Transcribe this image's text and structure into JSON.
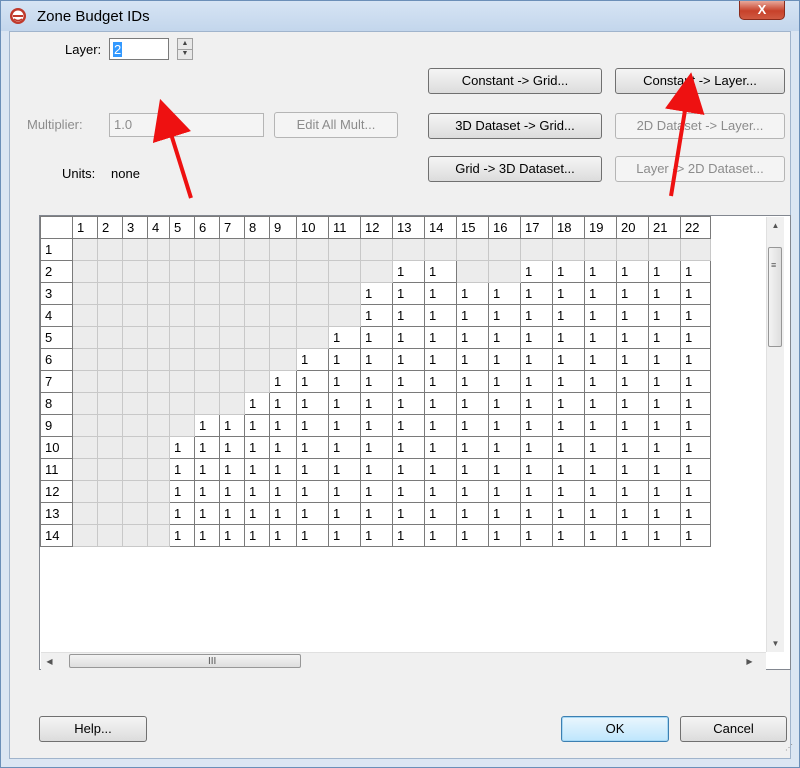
{
  "window": {
    "title": "Zone Budget IDs",
    "close_label": "X"
  },
  "form": {
    "layer_label": "Layer:",
    "layer_value": "2",
    "multiplier_label": "Multiplier:",
    "multiplier_value": "1.0",
    "units_label": "Units:",
    "units_value": "none",
    "edit_all_mult": "Edit All Mult..."
  },
  "buttons": {
    "constant_grid": "Constant -> Grid...",
    "constant_layer": "Constant -> Layer...",
    "dataset_3d_grid": "3D Dataset -> Grid...",
    "dataset_2d_layer": "2D Dataset -> Layer...",
    "grid_3d_dataset": "Grid -> 3D Dataset...",
    "layer_2d_dataset": "Layer -> 2D Dataset...",
    "help": "Help...",
    "ok": "OK",
    "cancel": "Cancel"
  },
  "grid": {
    "columns": [
      "1",
      "2",
      "3",
      "4",
      "5",
      "6",
      "7",
      "8",
      "9",
      "10",
      "11",
      "12",
      "13",
      "14",
      "15",
      "16",
      "17",
      "18",
      "19",
      "20",
      "21",
      "22"
    ],
    "rows": [
      {
        "label": "1",
        "cells": [
          "",
          "",
          "",
          "",
          "",
          "",
          "",
          "",
          "",
          "",
          "",
          "",
          "",
          "",
          "",
          "",
          "",
          "",
          "",
          "",
          "",
          ""
        ]
      },
      {
        "label": "2",
        "cells": [
          "",
          "",
          "",
          "",
          "",
          "",
          "",
          "",
          "",
          "",
          "",
          "",
          "1",
          "1",
          "",
          "",
          "1",
          "1",
          "1",
          "1",
          "1",
          "1"
        ]
      },
      {
        "label": "3",
        "cells": [
          "",
          "",
          "",
          "",
          "",
          "",
          "",
          "",
          "",
          "",
          "",
          "1",
          "1",
          "1",
          "1",
          "1",
          "1",
          "1",
          "1",
          "1",
          "1",
          "1"
        ]
      },
      {
        "label": "4",
        "cells": [
          "",
          "",
          "",
          "",
          "",
          "",
          "",
          "",
          "",
          "",
          "",
          "1",
          "1",
          "1",
          "1",
          "1",
          "1",
          "1",
          "1",
          "1",
          "1",
          "1"
        ]
      },
      {
        "label": "5",
        "cells": [
          "",
          "",
          "",
          "",
          "",
          "",
          "",
          "",
          "",
          "",
          "1",
          "1",
          "1",
          "1",
          "1",
          "1",
          "1",
          "1",
          "1",
          "1",
          "1",
          "1"
        ]
      },
      {
        "label": "6",
        "cells": [
          "",
          "",
          "",
          "",
          "",
          "",
          "",
          "",
          "",
          "1",
          "1",
          "1",
          "1",
          "1",
          "1",
          "1",
          "1",
          "1",
          "1",
          "1",
          "1",
          "1"
        ]
      },
      {
        "label": "7",
        "cells": [
          "",
          "",
          "",
          "",
          "",
          "",
          "",
          "",
          "1",
          "1",
          "1",
          "1",
          "1",
          "1",
          "1",
          "1",
          "1",
          "1",
          "1",
          "1",
          "1",
          "1"
        ]
      },
      {
        "label": "8",
        "cells": [
          "",
          "",
          "",
          "",
          "",
          "",
          "",
          "1",
          "1",
          "1",
          "1",
          "1",
          "1",
          "1",
          "1",
          "1",
          "1",
          "1",
          "1",
          "1",
          "1",
          "1"
        ]
      },
      {
        "label": "9",
        "cells": [
          "",
          "",
          "",
          "",
          "",
          "1",
          "1",
          "1",
          "1",
          "1",
          "1",
          "1",
          "1",
          "1",
          "1",
          "1",
          "1",
          "1",
          "1",
          "1",
          "1",
          "1"
        ]
      },
      {
        "label": "10",
        "cells": [
          "",
          "",
          "",
          "",
          "1",
          "1",
          "1",
          "1",
          "1",
          "1",
          "1",
          "1",
          "1",
          "1",
          "1",
          "1",
          "1",
          "1",
          "1",
          "1",
          "1",
          "1"
        ]
      },
      {
        "label": "11",
        "cells": [
          "",
          "",
          "",
          "",
          "1",
          "1",
          "1",
          "1",
          "1",
          "1",
          "1",
          "1",
          "1",
          "1",
          "1",
          "1",
          "1",
          "1",
          "1",
          "1",
          "1",
          "1"
        ]
      },
      {
        "label": "12",
        "cells": [
          "",
          "",
          "",
          "",
          "1",
          "1",
          "1",
          "1",
          "1",
          "1",
          "1",
          "1",
          "1",
          "1",
          "1",
          "1",
          "1",
          "1",
          "1",
          "1",
          "1",
          "1"
        ]
      },
      {
        "label": "13",
        "cells": [
          "",
          "",
          "",
          "",
          "1",
          "1",
          "1",
          "1",
          "1",
          "1",
          "1",
          "1",
          "1",
          "1",
          "1",
          "1",
          "1",
          "1",
          "1",
          "1",
          "1",
          "1"
        ]
      },
      {
        "label": "14",
        "cells": [
          "",
          "",
          "",
          "",
          "1",
          "1",
          "1",
          "1",
          "1",
          "1",
          "1",
          "1",
          "1",
          "1",
          "1",
          "1",
          "1",
          "1",
          "1",
          "1",
          "1",
          "1"
        ]
      }
    ]
  },
  "scrollbar": {
    "grip_v": "≡",
    "grip_h": "III"
  },
  "icons": {
    "app": "zone-budget-app-icon",
    "spin_up": "spin-up-icon",
    "spin_down": "spin-down-icon"
  },
  "colors": {
    "annotation_arrow": "#ee1111",
    "selection": "#3399ff"
  }
}
